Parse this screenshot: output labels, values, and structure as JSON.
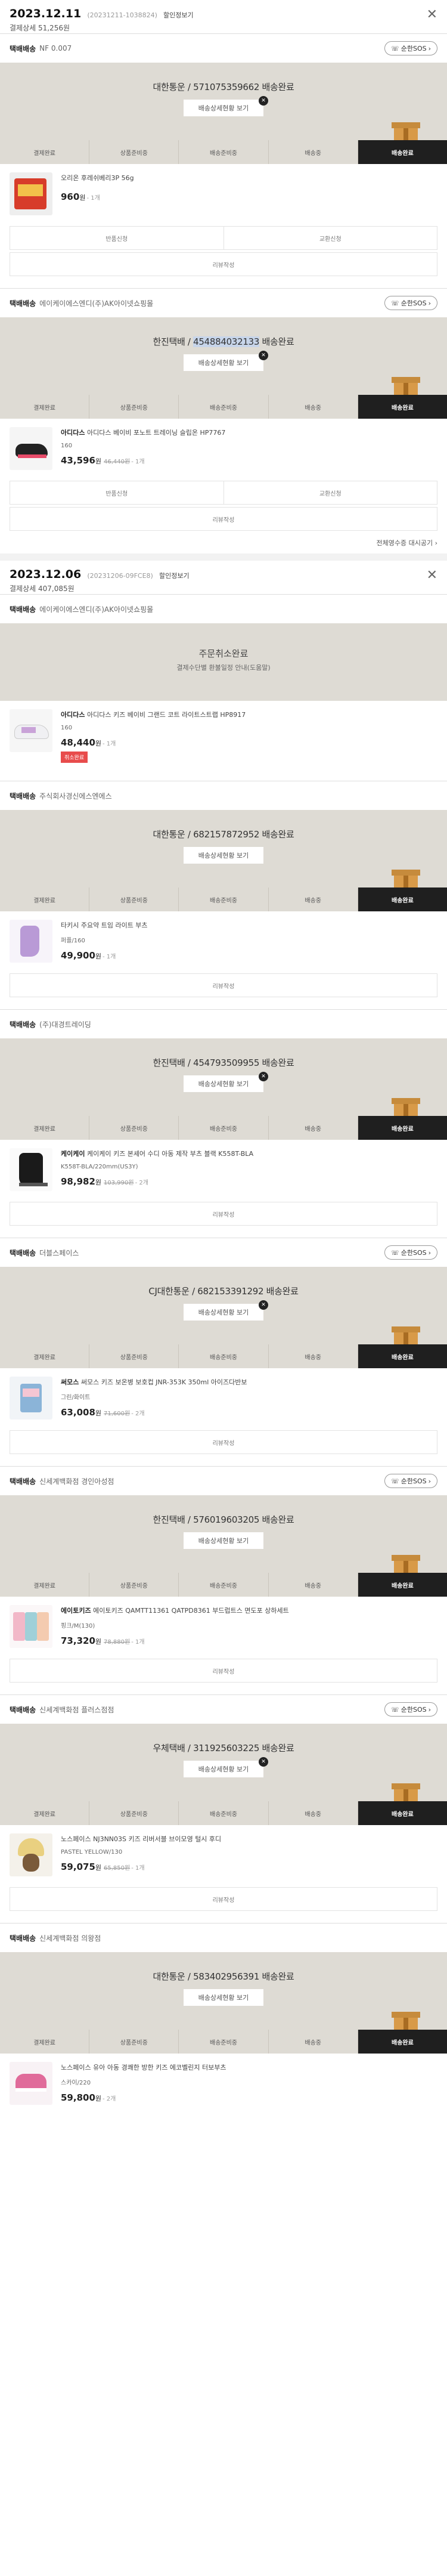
{
  "orders": [
    {
      "date": "2023.12.11",
      "order_no": "(20231211-1038824)",
      "detail": "할인정보기",
      "paid": "결제상세 51,256원",
      "close": "✕",
      "groups": [
        {
          "seller_label": "택배배송",
          "seller": "NF 0.007",
          "btn": "순한SOS",
          "tracking_pre": "대한통운 / ",
          "tracking_no": "571075359662",
          "tracking_post": " 배송완료",
          "track_btn": "배송상세현황 보기",
          "product": {
            "name_brand": "",
            "name": "오리온 후레쉬베리3P 56g",
            "option": "",
            "price": "960",
            "won": "원",
            "orig": "",
            "qty": "- 1개"
          },
          "buttons": [
            "반품신청",
            "교환신청"
          ],
          "review": "리뷰작성"
        },
        {
          "seller_label": "택배배송",
          "seller": "에이케이에스엔디(주)AK아이넷쇼핑몰",
          "btn": "순한SOS",
          "tracking_pre": "한진택배 / ",
          "tracking_no": "454884032133",
          "tracking_post": " 배송완료",
          "track_btn": "배송상세현황 보기",
          "product": {
            "name_brand": "아디다스",
            "name": "아디다스 베이비 포노트 트레이닝 슬립온 HP7767",
            "option": "160",
            "price": "43,596",
            "won": "원",
            "orig": "46,440원",
            "qty": "- 1개"
          },
          "buttons": [
            "반품신청",
            "교환신청"
          ],
          "review": "리뷰작성"
        }
      ],
      "receipt": "전체영수증 대시공기 ›"
    },
    {
      "date": "2023.12.06",
      "order_no": "(20231206-09FCE8)",
      "detail": "할인정보기",
      "paid": "결제상세 407,085원",
      "close": "✕",
      "cancel_group": {
        "seller_label": "택배배송",
        "seller": "에이케이에스엔디(주)AK아이넷쇼핑몰",
        "title": "주문취소완료",
        "sub": "결제수단별 환불일정 안내(도움말)",
        "product": {
          "name_brand": "아디다스",
          "name": "아디다스 키즈 베이비 그랜드 코트 라이트스트랩 HP8917",
          "option": "160",
          "price": "48,440",
          "won": "원",
          "qty": "- 1개",
          "tag": "취소완료"
        }
      },
      "groups": [
        {
          "seller_label": "택배배송",
          "seller": "주식회사경신에스엔에스",
          "btn": "",
          "tracking_pre": "대한통운 / ",
          "tracking_no": "682157872952",
          "tracking_post": " 배송완료",
          "track_btn": "배송상세현황 보기",
          "product": {
            "name_brand": "",
            "name": "타키시 주요약 트임 라이트 부츠",
            "option": "퍼플/160",
            "price": "49,900",
            "won": "원",
            "orig": "",
            "qty": "- 1개"
          },
          "buttons": [],
          "review": "리뷰작성"
        },
        {
          "seller_label": "택배배송",
          "seller": "(주)대경트레이딩",
          "btn": "",
          "tracking_pre": "한진택배 / ",
          "tracking_no": "454793509955",
          "tracking_post": " 배송완료",
          "track_btn": "배송상세현황 보기",
          "product": {
            "name_brand": "케이케이",
            "name": "케이케이 키즈 본셰어 수디 아동 제작 부츠 블랙 K558T-BLA",
            "option": "K558T-BLA/220mm(US3Y)",
            "price": "98,982",
            "won": "원",
            "orig": "103,990원",
            "qty": "- 2개"
          },
          "buttons": [],
          "review": "리뷰작성"
        },
        {
          "seller_label": "택배배송",
          "seller": "더블스페이스",
          "btn": "순한SOS",
          "tracking_pre": "CJ대한통운 / ",
          "tracking_no": "682153391292",
          "tracking_post": " 배송완료",
          "track_btn": "배송상세현황 보기",
          "product": {
            "name_brand": "써모스",
            "name": "써모스 키즈 보온병 보호컵 JNR-353K 350ml 아이즈다반보",
            "option": "그린/화이트",
            "price": "63,008",
            "won": "원",
            "orig": "71,600원",
            "qty": "- 2개"
          },
          "buttons": [],
          "review": "리뷰작성"
        },
        {
          "seller_label": "택배배송",
          "seller": "신세계백화점 경인아성점",
          "btn": "순한SOS",
          "tracking_pre": "한진택배 / ",
          "tracking_no": "576019603205",
          "tracking_post": " 배송완료",
          "track_btn": "배송상세현황 보기",
          "product": {
            "name_brand": "에이토키즈",
            "name": "에이토키즈 QAMTT11361 QATPD8361 부드럽트스 면도포 상하세트",
            "option": "핑크/M(130)",
            "price": "73,320",
            "won": "원",
            "orig": "78,880원",
            "qty": "- 1개"
          },
          "buttons": [],
          "review": "리뷰작성"
        },
        {
          "seller_label": "택배배송",
          "seller": "신세계백화점 플러스점점",
          "btn": "순한SOS",
          "tracking_pre": "우체택배 / ",
          "tracking_no": "311925603225",
          "tracking_post": " 배송완료",
          "track_btn": "배송상세현황 보기",
          "product": {
            "name_brand": "",
            "name": "노스페이스 NJ3NN03S 키즈 리버서블 브이모영 털시 후디",
            "option": "PASTEL YELLOW/130",
            "price": "59,075",
            "won": "원",
            "orig": "65,850원",
            "qty": "- 1개"
          },
          "buttons": [],
          "review": "리뷰작성"
        },
        {
          "seller_label": "택배배송",
          "seller": "신세계백화점 의왕점",
          "btn": "",
          "tracking_pre": "대한통운 / ",
          "tracking_no": "583402956391",
          "tracking_post": " 배송완료",
          "track_btn": "배송상세현황 보기",
          "product": {
            "name_brand": "",
            "name": "노스페이스 유아 아동 경쾌한 방한 키즈 에코벨린지 터보부츠",
            "option": "스카이/220",
            "price": "59,800",
            "won": "원",
            "orig": "",
            "qty": "- 2개"
          },
          "buttons": [],
          "review": ""
        }
      ]
    }
  ],
  "steps": [
    "결제완료",
    "상품준비중",
    "배송준비중",
    "배송중",
    "배송완료"
  ],
  "colors": {
    "status_bg": "#dedbd4",
    "active_step": "#1f1f1f",
    "cancel_tag": "#e84c4c"
  }
}
